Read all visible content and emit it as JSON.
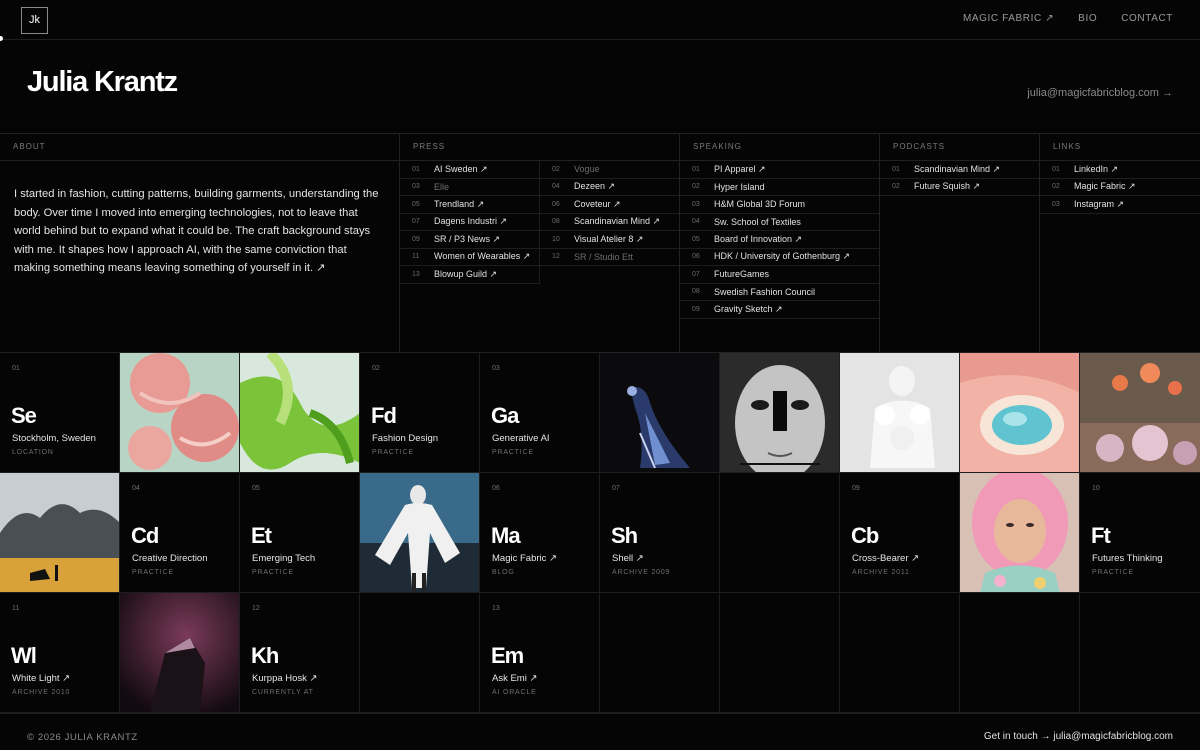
{
  "nav": {
    "logo": "Jk",
    "links": [
      "MAGIC FABRIC ↗",
      "BIO",
      "CONTACT"
    ]
  },
  "hero": {
    "name": "Julia Krantz",
    "email": "julia@magicfabricblog.com →"
  },
  "about": {
    "heading": "ABOUT",
    "text": "I started in fashion, cutting patterns, building garments, understanding the body. Over time I moved into emerging technologies, not to leave that world behind but to expand what it could be. The craft background stays with me. It shapes how I approach AI, with the same conviction that making something means leaving something of yourself in it. ↗"
  },
  "press": {
    "heading": "PRESS",
    "left": [
      {
        "n": "01",
        "label": "AI Sweden ↗"
      },
      {
        "n": "03",
        "label": "Elle",
        "dim": true
      },
      {
        "n": "05",
        "label": "Trendland ↗"
      },
      {
        "n": "07",
        "label": "Dagens Industri ↗"
      },
      {
        "n": "09",
        "label": "SR / P3 News ↗"
      },
      {
        "n": "11",
        "label": "Women of Wearables ↗"
      },
      {
        "n": "13",
        "label": "Blowup Guild ↗"
      }
    ],
    "right": [
      {
        "n": "02",
        "label": "Vogue",
        "dim": true
      },
      {
        "n": "04",
        "label": "Dezeen ↗"
      },
      {
        "n": "06",
        "label": "Coveteur ↗"
      },
      {
        "n": "08",
        "label": "Scandinavian Mind ↗"
      },
      {
        "n": "10",
        "label": "Visual Atelier 8 ↗"
      },
      {
        "n": "12",
        "label": "SR / Studio Ett",
        "dim": true
      }
    ]
  },
  "speaking": {
    "heading": "SPEAKING",
    "items": [
      {
        "n": "01",
        "label": "PI Apparel ↗"
      },
      {
        "n": "02",
        "label": "Hyper Island"
      },
      {
        "n": "03",
        "label": "H&M Global 3D Forum"
      },
      {
        "n": "04",
        "label": "Sw. School of Textiles"
      },
      {
        "n": "05",
        "label": "Board of Innovation ↗"
      },
      {
        "n": "06",
        "label": "HDK / University of Gothenburg ↗"
      },
      {
        "n": "07",
        "label": "FutureGames"
      },
      {
        "n": "08",
        "label": "Swedish Fashion Council"
      },
      {
        "n": "09",
        "label": "Gravity Sketch ↗"
      }
    ]
  },
  "podcasts": {
    "heading": "PODCASTS",
    "items": [
      {
        "n": "01",
        "label": "Scandinavian Mind ↗"
      },
      {
        "n": "02",
        "label": "Future Squish ↗"
      }
    ]
  },
  "links": {
    "heading": "LINKS",
    "items": [
      {
        "n": "01",
        "label": "LinkedIn ↗"
      },
      {
        "n": "02",
        "label": "Magic Fabric ↗"
      },
      {
        "n": "03",
        "label": "Instagram ↗"
      }
    ]
  },
  "tiles": [
    {
      "num": "01",
      "abbr": "Se",
      "name": "Stockholm, Sweden",
      "cat": "LOCATION"
    },
    {
      "num": "02",
      "abbr": "Fd",
      "name": "Fashion Design",
      "cat": "PRACTICE"
    },
    {
      "num": "03",
      "abbr": "Ga",
      "name": "Generative AI",
      "cat": "PRACTICE"
    },
    {
      "num": "04",
      "abbr": "Cd",
      "name": "Creative Direction",
      "cat": "PRACTICE"
    },
    {
      "num": "05",
      "abbr": "Et",
      "name": "Emerging Tech",
      "cat": "PRACTICE"
    },
    {
      "num": "06",
      "abbr": "Ma",
      "name": "Magic Fabric ↗",
      "cat": "BLOG"
    },
    {
      "num": "07",
      "abbr": "Sh",
      "name": "Shell ↗",
      "cat": "ARCHIVE   2009"
    },
    {
      "num": "09",
      "abbr": "Cb",
      "name": "Cross-Bearer ↗",
      "cat": "ARCHIVE   2011"
    },
    {
      "num": "10",
      "abbr": "Ft",
      "name": "Futures Thinking",
      "cat": "PRACTICE"
    },
    {
      "num": "11",
      "abbr": "Wl",
      "name": "White Light ↗",
      "cat": "ARCHIVE   2010"
    },
    {
      "num": "12",
      "abbr": "Kh",
      "name": "Kurppa Hosk ↗",
      "cat": "CURRENTLY AT"
    },
    {
      "num": "13",
      "abbr": "Em",
      "name": "Ask Emi ↗",
      "cat": "AI ORACLE"
    }
  ],
  "footer": {
    "copyright": "© 2026 JULIA KRANTZ",
    "touch": "Get in touch → julia@magicfabricblog.com"
  }
}
